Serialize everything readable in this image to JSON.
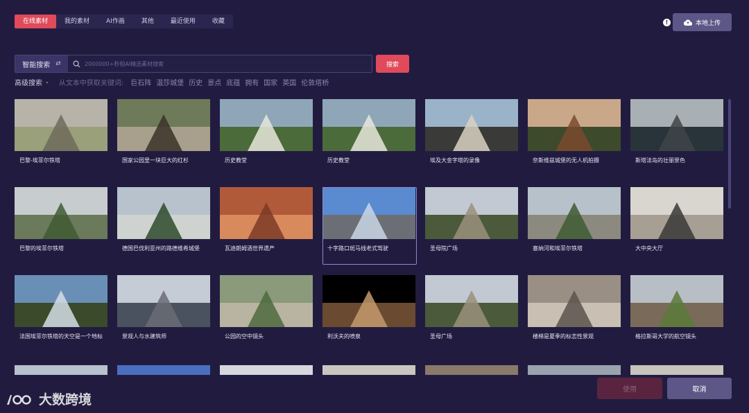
{
  "tabs": [
    "在线素材",
    "我的素材",
    "AI作画",
    "其他",
    "最近使用",
    "收藏"
  ],
  "upload_label": "本地上传",
  "search": {
    "mode": "智能搜索",
    "placeholder": "2000000+秒拍AI精选素材搜索",
    "button": "搜索"
  },
  "advanced": {
    "label": "高级搜索",
    "prefix": "从文本中获取关键词:",
    "keywords": [
      "巨石阵",
      "温莎城堡",
      "历史",
      "景点",
      "底蕴",
      "拥有",
      "国家",
      "英国",
      "伦敦塔桥"
    ]
  },
  "items": [
    {
      "caption": "巴黎-埃菲尔铁塔",
      "palette": [
        "#b8b3a8",
        "#6f6b5c",
        "#9aa07a"
      ]
    },
    {
      "caption": "国家公园里一块巨大的红杉",
      "palette": [
        "#6e7a5a",
        "#3b3328",
        "#a8a08c"
      ]
    },
    {
      "caption": "历史教堂",
      "palette": [
        "#8fa6b8",
        "#e8e6dc",
        "#4b6b3a"
      ]
    },
    {
      "caption": "历史教堂",
      "palette": [
        "#8fa6b8",
        "#e8e6dc",
        "#4b6b3a"
      ]
    },
    {
      "caption": "埃及大金字塔的录像",
      "palette": [
        "#9bb3c9",
        "#d9d2c2",
        "#3a3a38"
      ]
    },
    {
      "caption": "奈斯维兹城堡的无人机拍摄",
      "palette": [
        "#c9a88a",
        "#7a4a2e",
        "#3e4a2c"
      ]
    },
    {
      "caption": "斯塔法岛的壮丽景色",
      "palette": [
        "#a9b0b3",
        "#3e4448",
        "#29343a"
      ]
    },
    {
      "caption": "巴黎的埃菲尔铁塔",
      "palette": [
        "#c7ccce",
        "#3f5a33",
        "#6b7a5a"
      ]
    },
    {
      "caption": "德国巴伐利亚州的路德维希城堡",
      "palette": [
        "#b7c2cc",
        "#2f4a2c",
        "#cfd3cf"
      ]
    },
    {
      "caption": "瓦迪朗姆酒世界遗产",
      "palette": [
        "#b05a3a",
        "#7c3a26",
        "#d98a5c"
      ]
    },
    {
      "caption": "十字路口斑马线老式驾驶",
      "palette": [
        "#5a8ad0",
        "#c9d6e6",
        "#6b6f75"
      ]
    },
    {
      "caption": "圣母院广场",
      "palette": [
        "#c2c9d2",
        "#9a8f7c",
        "#4a5a3a"
      ]
    },
    {
      "caption": "塞纳河和埃菲尔铁塔",
      "palette": [
        "#b6c1c9",
        "#3e5a32",
        "#8c8a7e"
      ]
    },
    {
      "caption": "大中央大厅",
      "palette": [
        "#d9d6d0",
        "#3a3836",
        "#a89f94"
      ]
    },
    {
      "caption": "法国埃菲尔铁塔的天空是一个地标",
      "palette": [
        "#6a8fb6",
        "#d4dde6",
        "#3a4a2a"
      ]
    },
    {
      "caption": "景观人与水建筑师",
      "palette": [
        "#c6ccd6",
        "#6a6c74",
        "#4a5260"
      ]
    },
    {
      "caption": "公园的空中镜头",
      "palette": [
        "#8a9a7a",
        "#4d6a3e",
        "#b9b3a2"
      ]
    },
    {
      "caption": "利沃夫的喷泉",
      "palette": [
        "#000000",
        "#c49a6c",
        "#6b4a32"
      ]
    },
    {
      "caption": "圣母广场",
      "palette": [
        "#c2c9d2",
        "#9a8f7c",
        "#4a5a3a"
      ]
    },
    {
      "caption": "楼梯是夏季的标志性景观",
      "palette": [
        "#9a8f84",
        "#5c544c",
        "#c9bfb2"
      ]
    },
    {
      "caption": "格拉斯哥大学的航空镜头",
      "palette": [
        "#b8bec6",
        "#5a7a3a",
        "#7a6a5a"
      ]
    }
  ],
  "footer": {
    "use_label": "使用",
    "cancel_label": "取消",
    "watermark": "大数跨境"
  },
  "colors": {
    "background": "#211c3f",
    "accent": "#e04a5b",
    "secondary": "#5c5787"
  }
}
